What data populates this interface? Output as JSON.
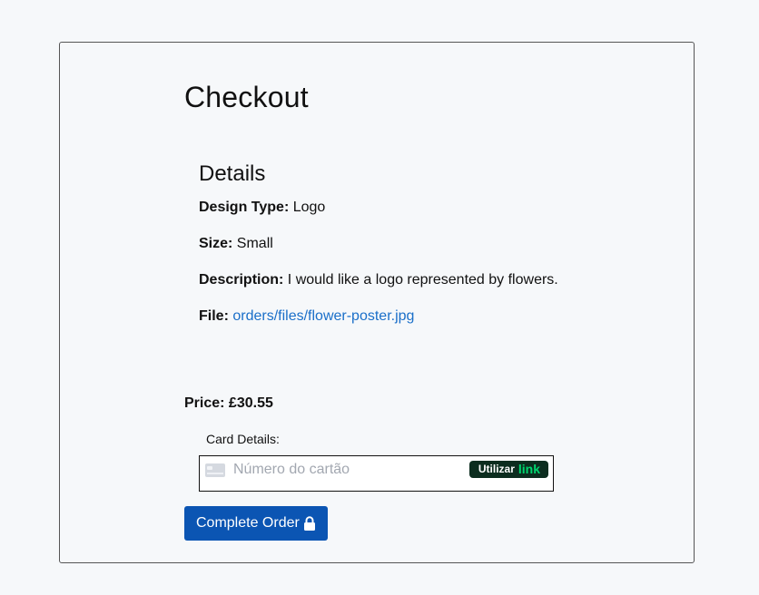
{
  "checkout": {
    "title": "Checkout",
    "details_heading": "Details",
    "details": {
      "design_type_label": "Design Type:",
      "design_type_value": "Logo",
      "size_label": "Size:",
      "size_value": "Small",
      "description_label": "Description:",
      "description_value": "I would like a logo represented by flowers.",
      "file_label": "File:",
      "file_value": "orders/files/flower-poster.jpg"
    },
    "price_label": "Price:",
    "price_value": "£30.55",
    "card_label": "Card Details:",
    "card_number_placeholder": "Número do cartão",
    "link_badge_prefix": "Utilizar",
    "link_badge_word": "link",
    "submit_label": "Complete Order",
    "submit_icon": "lock-icon"
  },
  "colors": {
    "background": "#f6f8fa",
    "link": "#1a6fc9",
    "primary_button": "#0b55b3",
    "link_badge_bg": "#0c2d1f",
    "link_badge_accent": "#00d66f"
  }
}
